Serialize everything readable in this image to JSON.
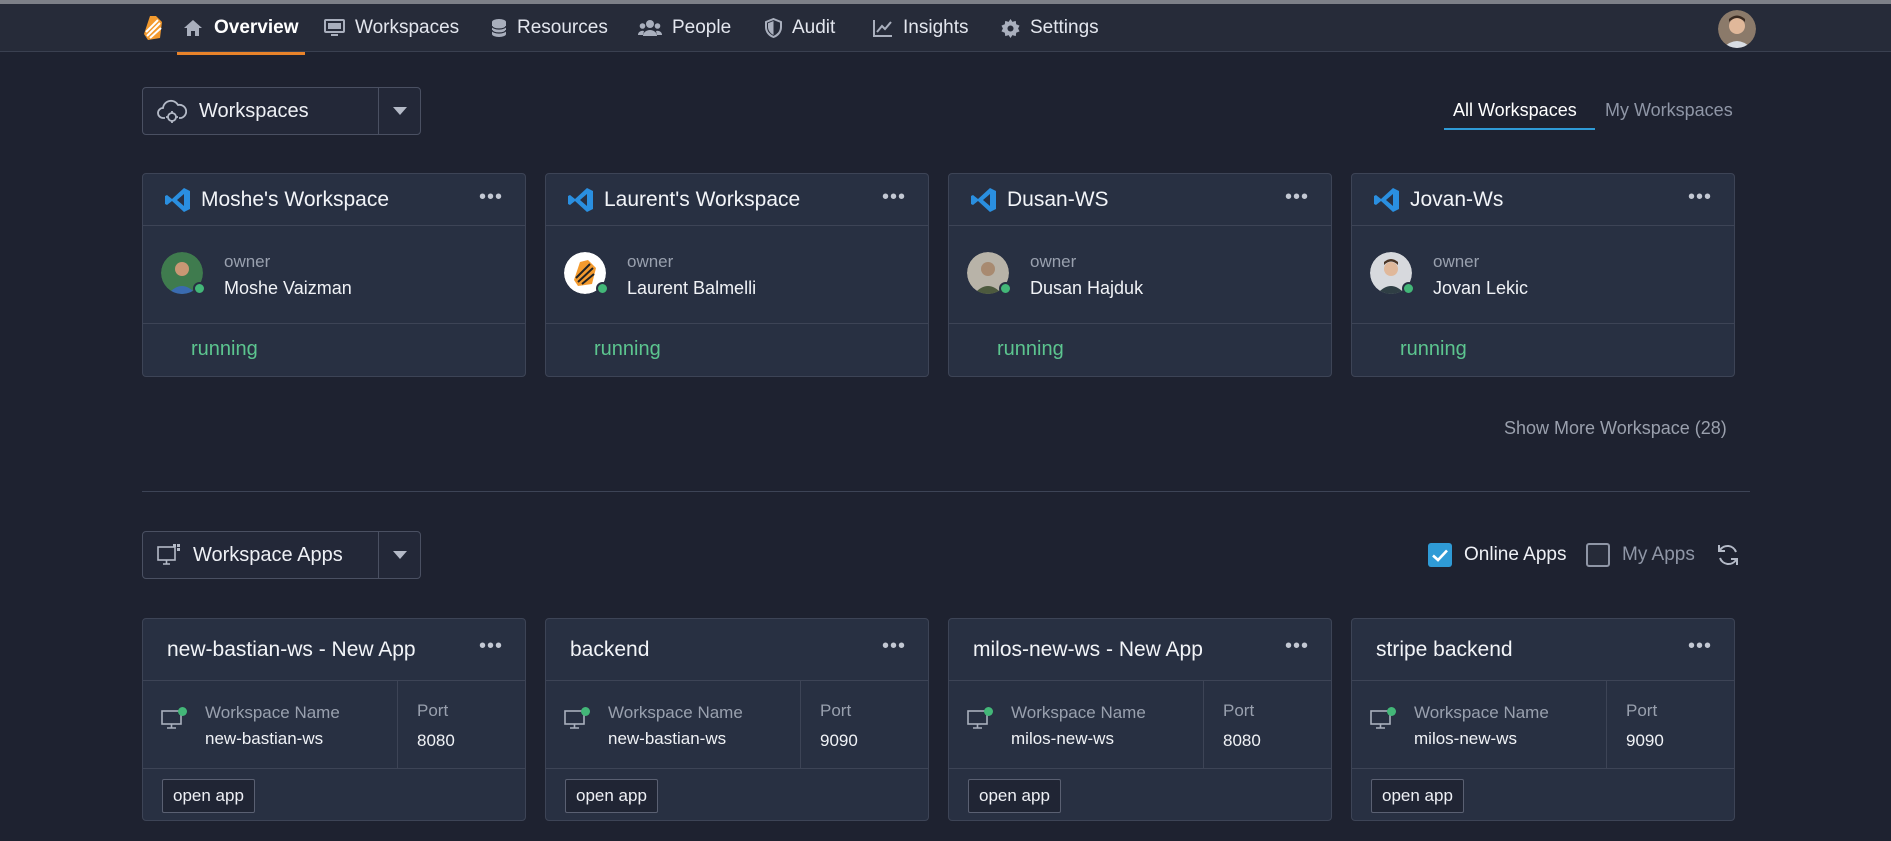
{
  "nav": {
    "items": [
      {
        "label": "Overview",
        "icon": "home-icon"
      },
      {
        "label": "Workspaces",
        "icon": "monitor-icon"
      },
      {
        "label": "Resources",
        "icon": "database-icon"
      },
      {
        "label": "People",
        "icon": "people-icon"
      },
      {
        "label": "Audit",
        "icon": "shield-icon"
      },
      {
        "label": "Insights",
        "icon": "chart-line-icon"
      },
      {
        "label": "Settings",
        "icon": "gear-icon"
      }
    ],
    "active": "Overview",
    "accent": "#e9832a"
  },
  "workspaces_section": {
    "selector_label": "Workspaces",
    "tabs": [
      "All Workspaces",
      "My Workspaces"
    ],
    "active_tab": "All Workspaces",
    "cards": [
      {
        "title": "Moshe's Workspace",
        "owner_label": "owner",
        "owner": "Moshe Vaizman",
        "status": "running"
      },
      {
        "title": "Laurent's Workspace",
        "owner_label": "owner",
        "owner": "Laurent Balmelli",
        "status": "running"
      },
      {
        "title": "Dusan-WS",
        "owner_label": "owner",
        "owner": "Dusan Hajduk",
        "status": "running"
      },
      {
        "title": "Jovan-Ws",
        "owner_label": "owner",
        "owner": "Jovan Lekic",
        "status": "running"
      }
    ],
    "show_more": "Show More Workspace (28)",
    "status_color": "#5cc58f"
  },
  "apps_section": {
    "selector_label": "Workspace Apps",
    "online_apps_label": "Online Apps",
    "online_apps_checked": true,
    "my_apps_label": "My Apps",
    "my_apps_checked": false,
    "cards": [
      {
        "title": "new-bastian-ws - New App",
        "ws_label": "Workspace Name",
        "ws_name": "new-bastian-ws",
        "port_label": "Port",
        "port": "8080",
        "button": "open app"
      },
      {
        "title": "backend",
        "ws_label": "Workspace Name",
        "ws_name": "new-bastian-ws",
        "port_label": "Port",
        "port": "9090",
        "button": "open app"
      },
      {
        "title": "milos-new-ws - New App",
        "ws_label": "Workspace Name",
        "ws_name": "milos-new-ws",
        "port_label": "Port",
        "port": "8080",
        "button": "open app"
      },
      {
        "title": "stripe backend",
        "ws_label": "Workspace Name",
        "ws_name": "milos-new-ws",
        "port_label": "Port",
        "port": "9090",
        "button": "open app"
      }
    ]
  }
}
